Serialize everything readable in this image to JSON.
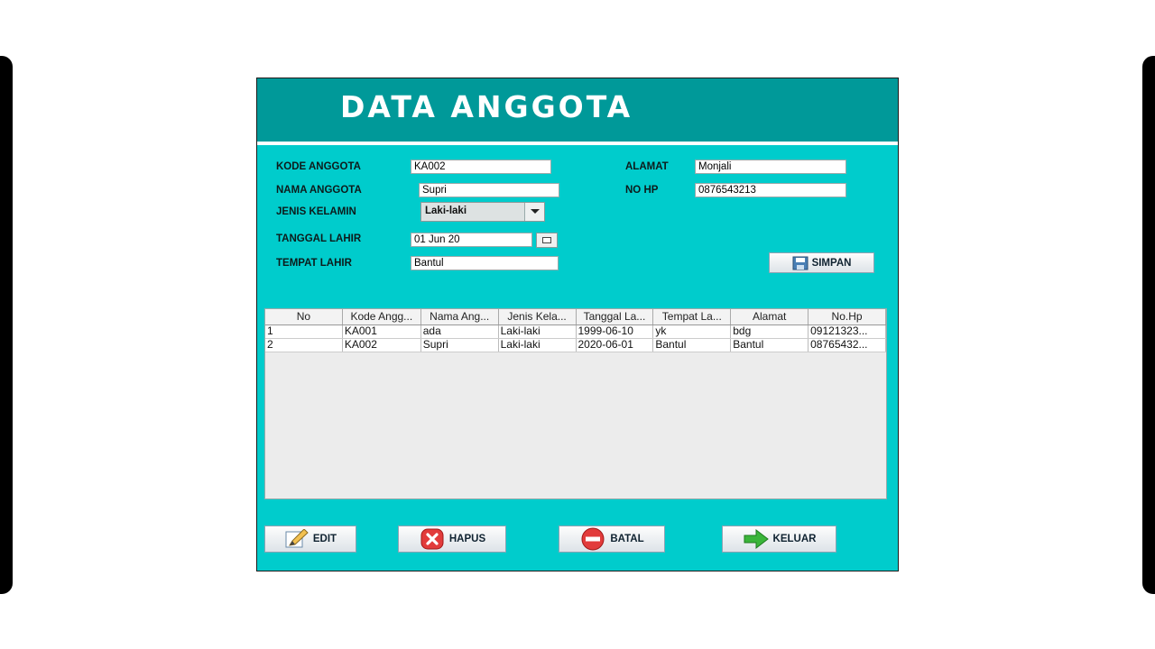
{
  "header": {
    "title": "DATA ANGGOTA"
  },
  "form": {
    "kode_label": "KODE ANGGOTA",
    "kode_value": "KA002",
    "nama_label": "NAMA ANGGOTA",
    "nama_value": "Supri",
    "jenis_label": "JENIS KELAMIN",
    "jenis_value": "Laki-laki",
    "tgl_label": "TANGGAL LAHIR",
    "tgl_value": "01 Jun 20",
    "tempat_label": "TEMPAT LAHIR",
    "tempat_value": "Bantul",
    "alamat_label": "ALAMAT",
    "alamat_value": "Monjali",
    "nohp_label": "NO HP",
    "nohp_value": "0876543213"
  },
  "buttons": {
    "simpan": "SIMPAN",
    "edit": "EDIT",
    "hapus": "HAPUS",
    "batal": "BATAL",
    "keluar": "KELUAR"
  },
  "table": {
    "columns": [
      "No",
      "Kode Angg...",
      "Nama Ang...",
      "Jenis Kela...",
      "Tanggal La...",
      "Tempat La...",
      "Alamat",
      "No.Hp"
    ],
    "rows": [
      [
        "1",
        "KA001",
        "ada",
        "Laki-laki",
        "1999-06-10",
        "yk",
        "bdg",
        "09121323..."
      ],
      [
        "2",
        "KA002",
        "Supri",
        "Laki-laki",
        "2020-06-01",
        "Bantul",
        "Bantul",
        "08765432..."
      ]
    ]
  },
  "icons": {
    "simpan": "floppy-disk-icon",
    "edit": "pencil-icon",
    "hapus": "x-circle-icon",
    "batal": "minus-circle-icon",
    "keluar": "arrow-right-icon"
  },
  "colors": {
    "panel": "#00cccc",
    "header": "#009999"
  }
}
